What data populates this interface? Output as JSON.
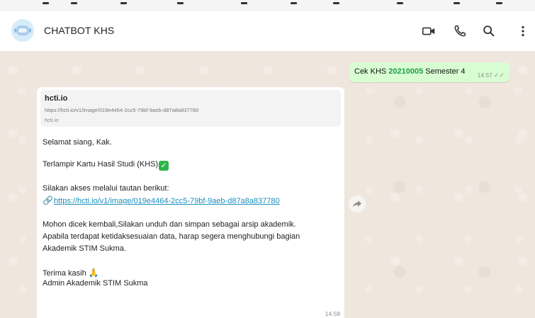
{
  "header": {
    "title": "CHATBOT KHS",
    "icons": [
      "video-call-icon",
      "voice-call-icon",
      "search-icon",
      "more-options-icon"
    ]
  },
  "outgoing": {
    "prefix": "Cek KHS ",
    "nim": "20210005",
    "suffix": " Semester 4",
    "time": "14.57"
  },
  "incoming": {
    "preview": {
      "title": "hcti.io",
      "url": "https://hcti.io/v1/image/019e4464-2cc5-79bf-9aeb-d87a8a837780",
      "domain": "hcti.io"
    },
    "greeting": "Selamat siang, Kak.",
    "attachment_line": "Terlampir Kartu Hasil Studi (KHS)",
    "access_line": "Silakan akses melalui tautan berikut:",
    "link": "https://hcti.io/v1/image/019e4464-2cc5-79bf-9aeb-d87a8a837780",
    "para1": "Mohon dicek kembali,Silakan unduh dan simpan sebagai arsip akademik.",
    "para2": "Apabila terdapat ketidaksesuaian data, harap segera menghubungi bagian",
    "para3": "Akademik STIM Sukma.",
    "thanks": "Terima kasih",
    "signature": "Admin Akademik STIM Sukma",
    "time": "14.58"
  },
  "colors": {
    "chat_background": "#efe7de",
    "outgoing_bubble": "#d9fdd3",
    "link": "#1b8fbf",
    "nim_highlight": "#1f9e4a"
  }
}
